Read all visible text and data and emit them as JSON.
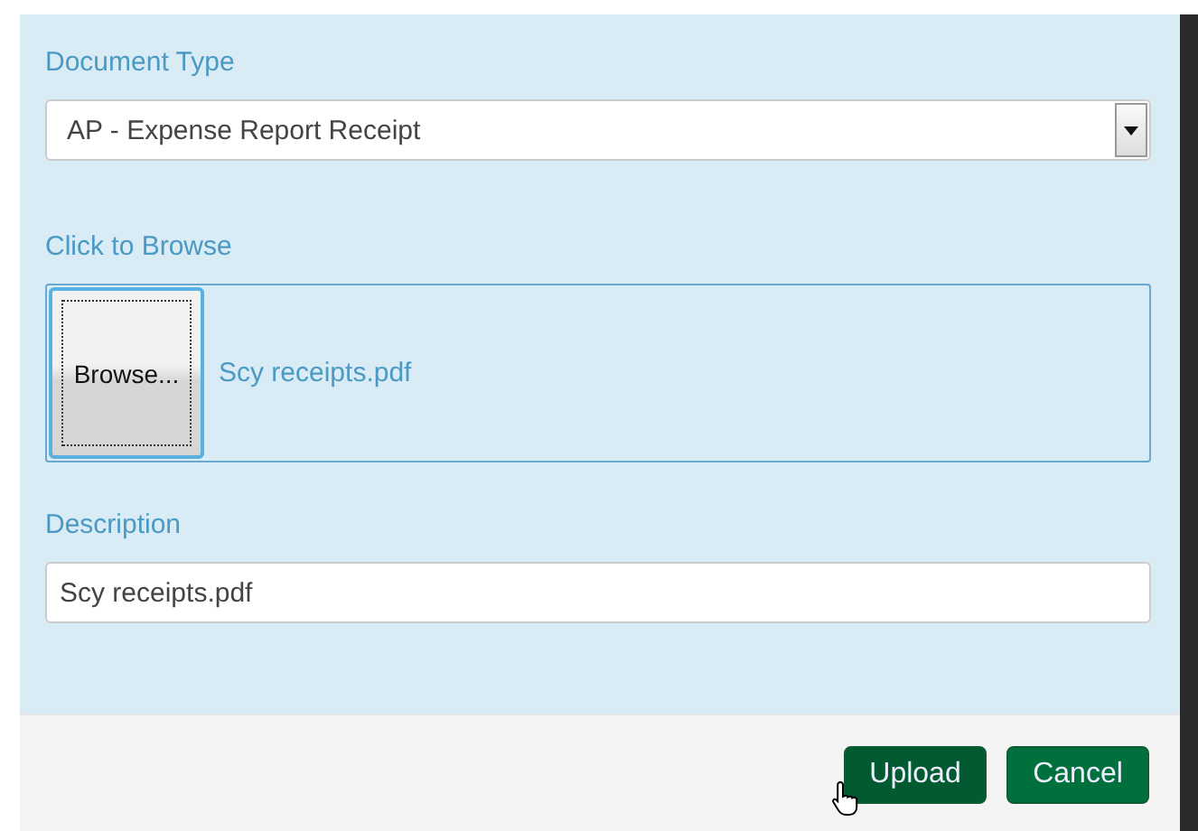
{
  "document_type": {
    "label": "Document Type",
    "value": "AP - Expense Report Receipt"
  },
  "file": {
    "label": "Click to Browse",
    "button": "Browse...",
    "file_name": "Scy receipts.pdf"
  },
  "description": {
    "label": "Description",
    "value": "Scy receipts.pdf"
  },
  "buttons": [
    {
      "label": "Upload",
      "hovered": true
    },
    {
      "label": "Cancel",
      "hovered": false
    }
  ]
}
